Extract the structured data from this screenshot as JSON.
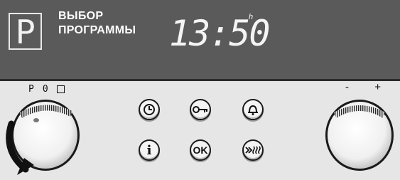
{
  "display": {
    "program_symbol": "P",
    "title_line1": "ВЫБОР",
    "title_line2": "ПРОГРАММЫ",
    "time": "13:50",
    "time_unit": "h"
  },
  "left_knob": {
    "mode_labels": [
      "P",
      "0"
    ],
    "mode_square": "square-icon"
  },
  "right_knob": {
    "minus_label": "-",
    "plus_label": "+"
  },
  "buttons": [
    {
      "name": "clock-button",
      "icon": "clock-icon"
    },
    {
      "name": "key-lock-button",
      "icon": "key-icon"
    },
    {
      "name": "bell-button",
      "icon": "bell-icon"
    },
    {
      "name": "info-button",
      "label": "i"
    },
    {
      "name": "ok-button",
      "label": "OK"
    },
    {
      "name": "fast-heat-button",
      "icon": "fast-heat-icon"
    }
  ],
  "colors": {
    "display_bg": "#5a5a5a",
    "panel_bg": "#e6e6e6",
    "display_text": "#f4f4f4"
  }
}
